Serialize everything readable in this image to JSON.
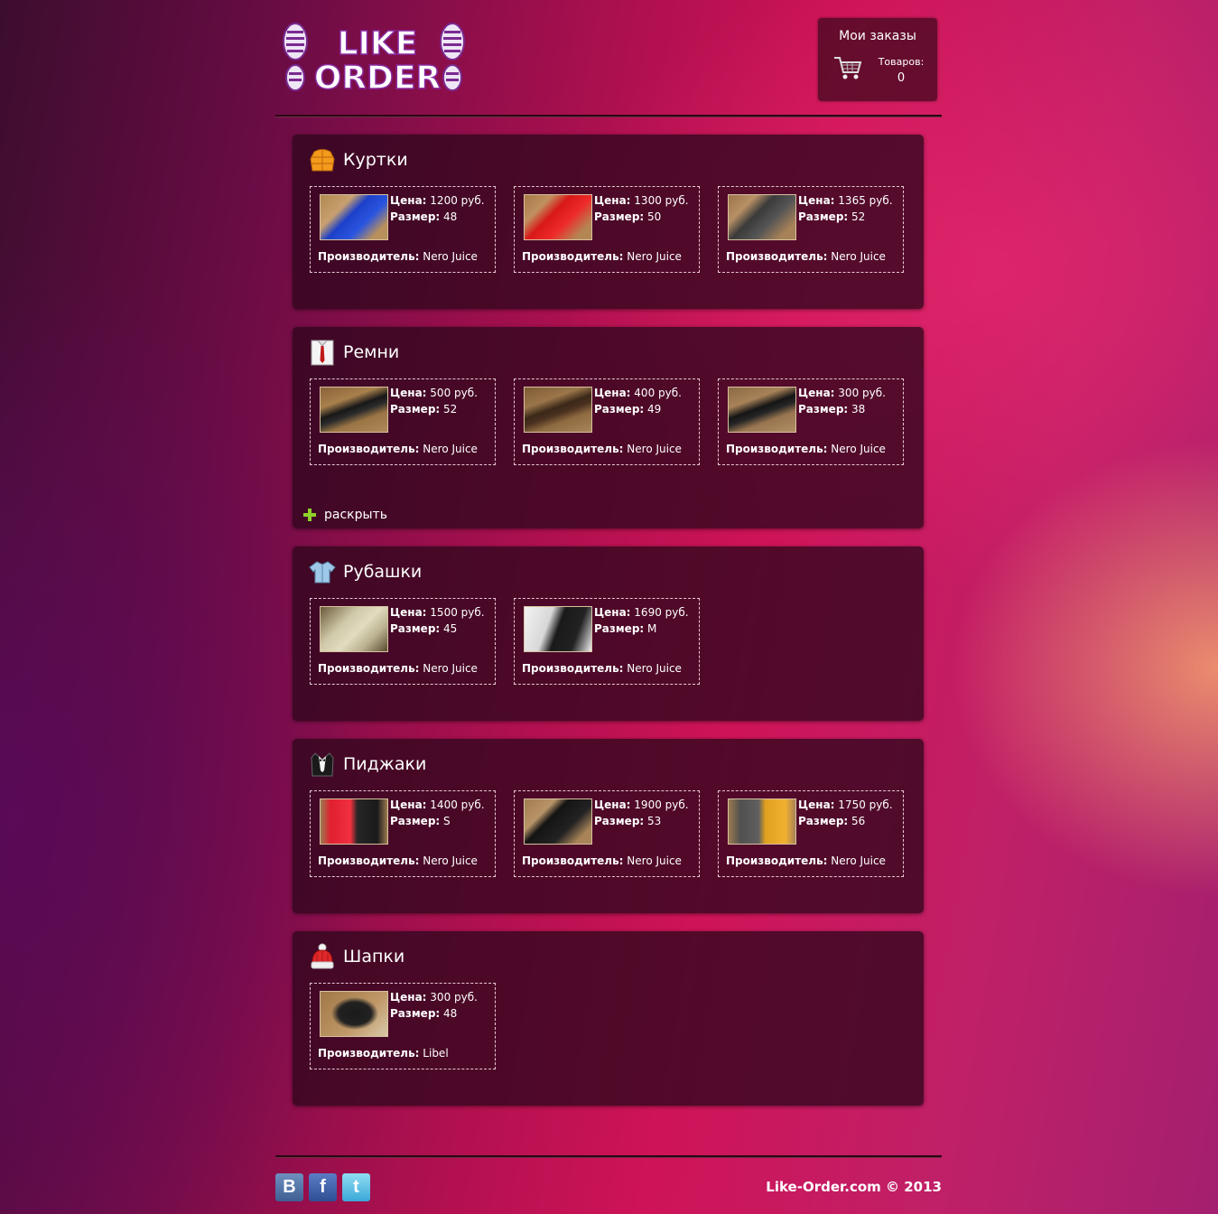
{
  "logo": {
    "line1": "LIKE",
    "line2": "ORDER"
  },
  "orders": {
    "title": "Мои заказы",
    "goods_label": "Товаров:",
    "goods_count": "0",
    "icon": "cart-icon"
  },
  "labels": {
    "price": "Цена:",
    "size": "Размер:",
    "maker": "Производитель:"
  },
  "categories": [
    {
      "title": "Куртки",
      "icon": "jacket-icon",
      "items": [
        {
          "price": "1200 руб.",
          "size": "48",
          "maker": "Nero Juice"
        },
        {
          "price": "1300 руб.",
          "size": "50",
          "maker": "Nero Juice"
        },
        {
          "price": "1365 руб.",
          "size": "52",
          "maker": "Nero Juice"
        }
      ]
    },
    {
      "title": "Ремни",
      "icon": "shirt-tie-icon",
      "expand_label": "раскрыть",
      "items": [
        {
          "price": "500 руб.",
          "size": "52",
          "maker": "Nero Juice"
        },
        {
          "price": "400 руб.",
          "size": "49",
          "maker": "Nero Juice"
        },
        {
          "price": "300 руб.",
          "size": "38",
          "maker": "Nero Juice"
        }
      ]
    },
    {
      "title": "Рубашки",
      "icon": "shirt-icon",
      "items": [
        {
          "price": "1500 руб.",
          "size": "45",
          "maker": "Nero Juice"
        },
        {
          "price": "1690 руб.",
          "size": "M",
          "maker": "Nero Juice"
        }
      ]
    },
    {
      "title": "Пиджаки",
      "icon": "tuxedo-icon",
      "items": [
        {
          "price": "1400 руб.",
          "size": "S",
          "maker": "Nero Juice"
        },
        {
          "price": "1900 руб.",
          "size": "53",
          "maker": "Nero Juice"
        },
        {
          "price": "1750 руб.",
          "size": "56",
          "maker": "Nero Juice"
        }
      ]
    },
    {
      "title": "Шапки",
      "icon": "hat-icon",
      "items": [
        {
          "price": "300 руб.",
          "size": "48",
          "maker": "Libel"
        }
      ]
    }
  ],
  "footer": {
    "social": [
      {
        "label": "B",
        "icon": "vk-icon"
      },
      {
        "label": "f",
        "icon": "facebook-icon"
      },
      {
        "label": "t",
        "icon": "twitter-icon"
      }
    ],
    "copyright": "Like-Order.com © 2013"
  }
}
